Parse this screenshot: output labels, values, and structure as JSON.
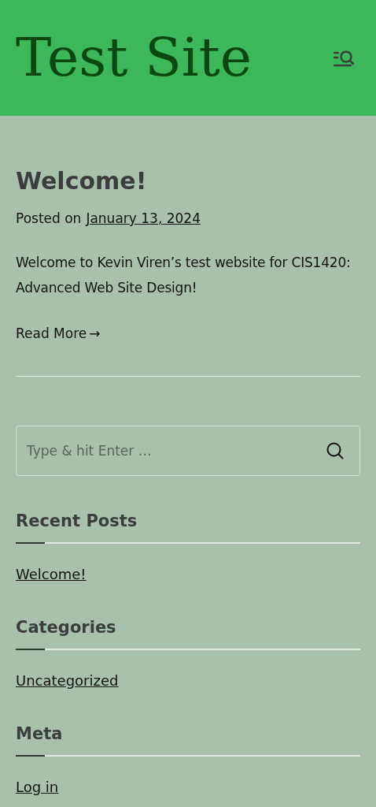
{
  "site_title": "Test Site",
  "post": {
    "title": "Welcome!",
    "posted_prefix": "Posted on",
    "date": "January 13, 2024",
    "excerpt": "Welcome to Kevin Viren’s test website for CIS1420: Advanced Web Site Design!",
    "read_more": "Read More",
    "read_more_arrow": "→"
  },
  "search": {
    "placeholder": "Type & hit Enter …"
  },
  "widgets": [
    {
      "title": "Recent Posts",
      "links": [
        "Welcome!"
      ]
    },
    {
      "title": "Categories",
      "links": [
        "Uncategorized"
      ]
    },
    {
      "title": "Meta",
      "links": [
        "Log in"
      ]
    }
  ]
}
